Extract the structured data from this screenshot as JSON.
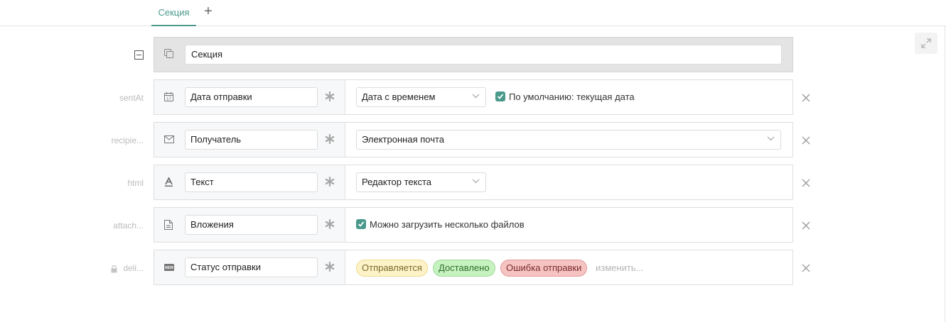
{
  "tabs": {
    "active_label": "Секция",
    "add_label": "+"
  },
  "section": {
    "title": "Секция"
  },
  "fields": [
    {
      "key": "sentAt",
      "icon": "calendar-icon",
      "name": "Дата отправки",
      "type": "Дата с временем",
      "option_label": "По умолчанию: текущая дата",
      "option_checked": true
    },
    {
      "key": "recipie...",
      "icon": "envelope-icon",
      "name": "Получатель",
      "type": "Электронная почта"
    },
    {
      "key": "html",
      "icon": "text-format-icon",
      "name": "Текст",
      "type": "Редактор текста"
    },
    {
      "key": "attach...",
      "icon": "document-icon",
      "name": "Вложения",
      "option_label": "Можно загрузить несколько файлов",
      "option_checked": true
    },
    {
      "key": "deli...",
      "key_locked": true,
      "icon": "status-new-icon",
      "name": "Статус отправки",
      "statuses": [
        {
          "label": "Отправляется",
          "color": "#fdf3c8"
        },
        {
          "label": "Доставлено",
          "color": "#c6f2c0"
        },
        {
          "label": "Ошибка отправки",
          "color": "#f6c3c3"
        }
      ],
      "change_label": "изменить..."
    }
  ],
  "colors": {
    "accent": "#4a9a8c",
    "section_bg": "#e4e4e4"
  }
}
